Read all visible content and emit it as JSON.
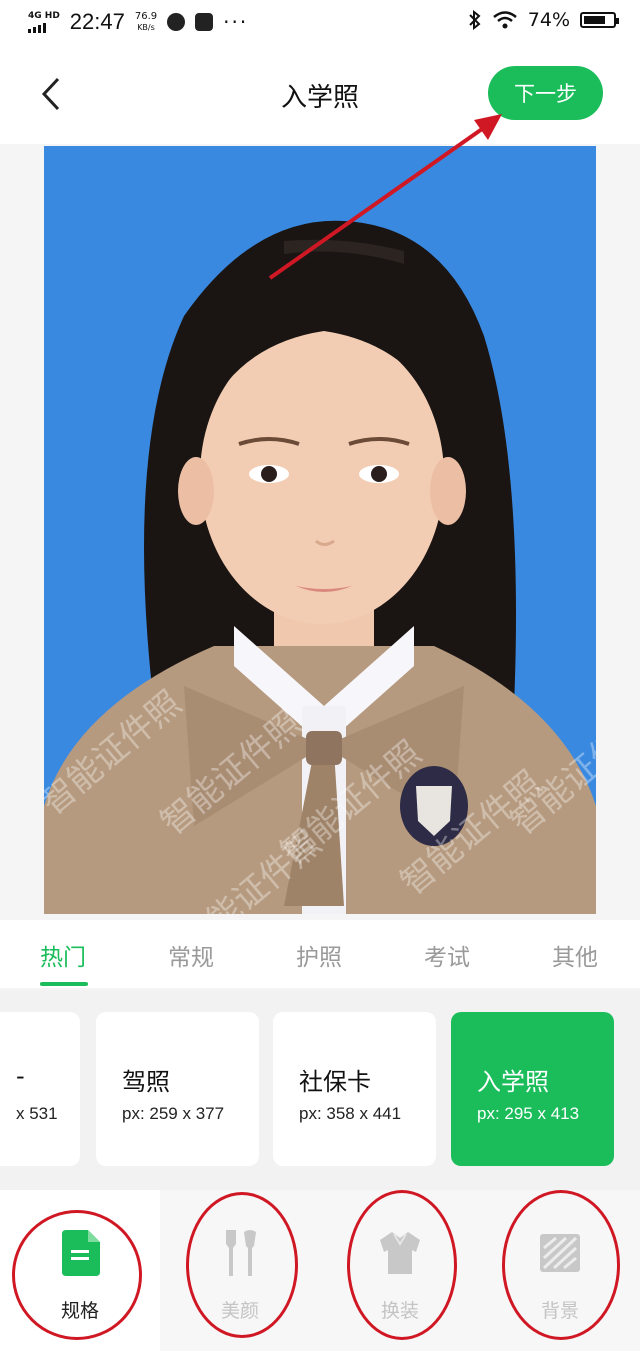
{
  "status": {
    "network": "4G HD",
    "time": "22:47",
    "speed_value": "76.9",
    "speed_unit": "KB/s",
    "more": "···",
    "battery": "74%",
    "battery_level": 0.74
  },
  "header": {
    "title": "入学照",
    "next_label": "下一步"
  },
  "photo": {
    "watermark": "智能证件照",
    "background_color": "#3a89e0"
  },
  "tabs": [
    {
      "label": "热门",
      "active": true
    },
    {
      "label": "常规",
      "active": false
    },
    {
      "label": "护照",
      "active": false
    },
    {
      "label": "考试",
      "active": false
    },
    {
      "label": "其他",
      "active": false
    }
  ],
  "cards": [
    {
      "name": "-",
      "px": "x 531",
      "selected": false
    },
    {
      "name": "驾照",
      "px": "px: 259 x 377",
      "selected": false
    },
    {
      "name": "社保卡",
      "px": "px: 358 x 441",
      "selected": false
    },
    {
      "name": "入学照",
      "px": "px: 295 x 413",
      "selected": true
    }
  ],
  "toolbar": [
    {
      "label": "规格",
      "icon": "spec-document-icon",
      "active": true
    },
    {
      "label": "美颜",
      "icon": "beauty-brush-icon",
      "active": false
    },
    {
      "label": "换装",
      "icon": "outfit-shirt-icon",
      "active": false
    },
    {
      "label": "背景",
      "icon": "background-hatch-icon",
      "active": false
    }
  ],
  "colors": {
    "accent": "#1bbd5b",
    "annotation": "#d01824"
  }
}
